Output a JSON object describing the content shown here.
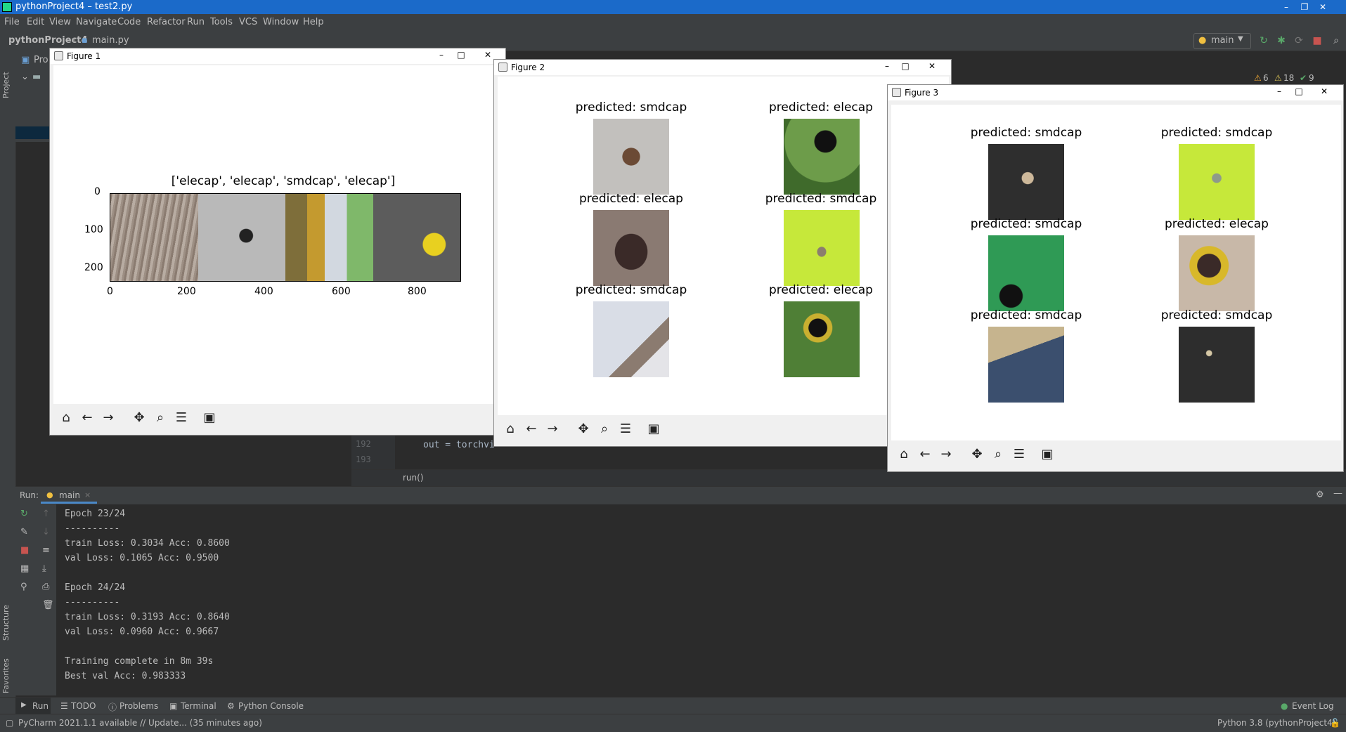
{
  "window": {
    "title": "pythonProject4 – test2.py"
  },
  "menu": [
    "File",
    "Edit",
    "View",
    "Navigate",
    "Code",
    "Refactor",
    "Run",
    "Tools",
    "VCS",
    "Window",
    "Help"
  ],
  "nav": {
    "project": "pythonProject4",
    "file": "main.py",
    "run_config": "main"
  },
  "warnings": {
    "warn": "6",
    "weak": "18",
    "ok": "9"
  },
  "sidebar": {
    "project": "Project",
    "structure": "Structure",
    "favorites": "Favorites"
  },
  "project_panel": {
    "label": "Pro"
  },
  "editor": {
    "lines": [
      {
        "num": "192",
        "code": "out = torchvi"
      },
      {
        "num": "193",
        "code": ""
      }
    ],
    "breadcrumb": "run()"
  },
  "run_panel": {
    "label": "Run:",
    "tab": "main",
    "console": [
      "Epoch 23/24",
      "----------",
      "train Loss: 0.3034 Acc: 0.8600",
      "val Loss: 0.1065 Acc: 0.9500",
      "",
      "Epoch 24/24",
      "----------",
      "train Loss: 0.3193 Acc: 0.8640",
      "val Loss: 0.0960 Acc: 0.9667",
      "",
      "Training complete in 8m 39s",
      "Best val Acc: 0.983333"
    ]
  },
  "bottom_tabs": [
    "Run",
    "TODO",
    "Problems",
    "Terminal",
    "Python Console"
  ],
  "event_log": "Event Log",
  "status": {
    "message": "PyCharm 2021.1.1 available // Update... (35 minutes ago)",
    "interpreter": "Python 3.8 (pythonProject4)"
  },
  "figure1": {
    "title": "Figure 1",
    "plot_title": "['elecap', 'elecap', 'smdcap', 'elecap']",
    "xticks": [
      "0",
      "200",
      "400",
      "600",
      "800"
    ],
    "yticks": [
      "0",
      "100",
      "200"
    ]
  },
  "figure2": {
    "title": "Figure 2",
    "predictions": [
      "predicted: smdcap",
      "predicted: elecap",
      "predicted: elecap",
      "predicted: smdcap",
      "predicted: smdcap",
      "predicted: elecap"
    ]
  },
  "figure3": {
    "title": "Figure 3",
    "predictions": [
      "predicted: smdcap",
      "predicted: smdcap",
      "predicted: smdcap",
      "predicted: elecap",
      "predicted: smdcap",
      "predicted: smdcap"
    ]
  },
  "colors": {
    "accent": "#1b6ac9",
    "ide_bg": "#2b2b2b",
    "panel": "#3c3f41",
    "warn": "#f0a732",
    "ok": "#59a869"
  }
}
